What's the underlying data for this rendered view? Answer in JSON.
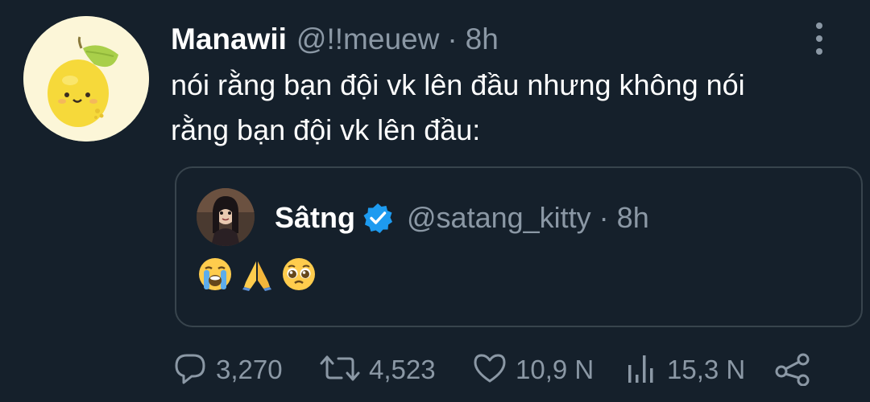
{
  "tweet": {
    "author": {
      "display_name": "Manawii",
      "handle": "@!!meuew",
      "separator": "·",
      "time": "8h",
      "avatar_icon": "lemon-avatar"
    },
    "text_lines": [
      "nói rằng bạn đội vk lên đầu nhưng không nói",
      "rằng bạn đội vk lên đầu:"
    ],
    "more_icon": "more-vertical-icon"
  },
  "quoted_tweet": {
    "display_name": "Sâtng",
    "handle": "@satang_kitty",
    "separator": "·",
    "time": "8h",
    "verified_icon": "verified-badge-icon",
    "emojis": [
      "loudly-crying-face",
      "folded-hands",
      "pleading-face"
    ]
  },
  "actions": {
    "reply": {
      "icon": "reply-icon",
      "count": "3,270"
    },
    "retweet": {
      "icon": "retweet-icon",
      "count": "4,523"
    },
    "like": {
      "icon": "heart-icon",
      "count": "10,9 N"
    },
    "views": {
      "icon": "views-icon",
      "count": "15,3 N"
    },
    "share": {
      "icon": "share-icon"
    }
  },
  "colors": {
    "background": "#15202b",
    "primary_text": "#ffffff",
    "secondary_text": "#8b98a5",
    "border": "#38444d",
    "verified": "#1d9bf0",
    "avatar_bg": "#fcf6d8"
  }
}
